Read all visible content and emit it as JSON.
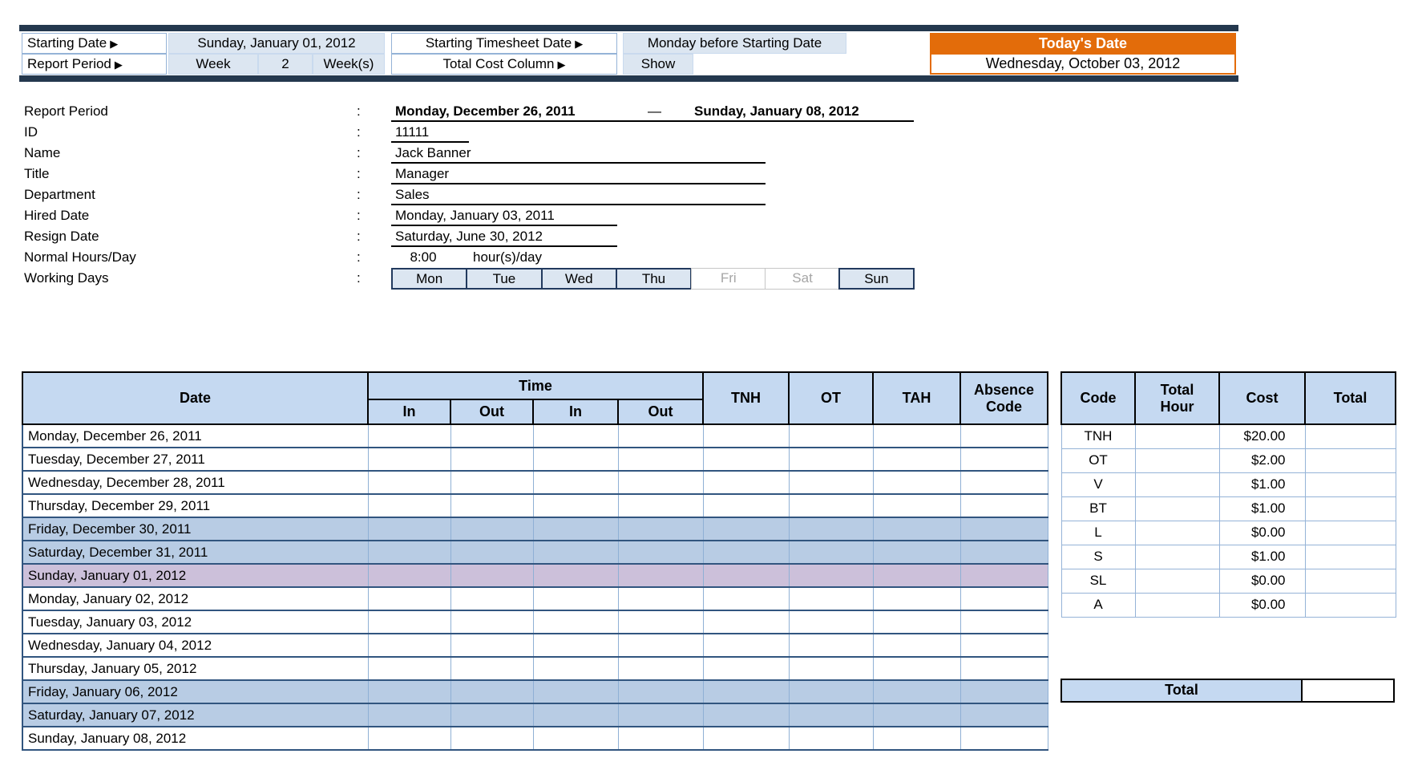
{
  "colors": {
    "accent_orange": "#e36c0a",
    "navy_bar": "#24384e",
    "table_header_fill": "#c5d9f1",
    "input_cell_fill": "#dce6f1",
    "weekend_row_fill": "#b8cce4",
    "start_date_row_fill": "#ccc0da"
  },
  "icons": {
    "triangle_right": "▶"
  },
  "topbar": {
    "starting_date": {
      "label": "Starting Date",
      "value": "Sunday, January 01, 2012"
    },
    "starting_timesheet_date": {
      "label": "Starting Timesheet Date",
      "value": "Monday before Starting Date"
    },
    "report_period": {
      "label": "Report Period",
      "unit": "Week",
      "count": "2",
      "unit_suffix": "Week(s)"
    },
    "total_cost_column": {
      "label": "Total Cost Column",
      "value": "Show"
    },
    "todays_date": {
      "label": "Today's Date",
      "value": "Wednesday, October 03, 2012"
    }
  },
  "info": {
    "colon": ":",
    "report_period": {
      "label": "Report Period",
      "start": "Monday, December 26, 2011",
      "dash": "—",
      "end": "Sunday, January 08, 2012"
    },
    "id": {
      "label": "ID",
      "value": "11111"
    },
    "name": {
      "label": "Name",
      "value": "Jack Banner"
    },
    "title": {
      "label": "Title",
      "value": "Manager"
    },
    "department": {
      "label": "Department",
      "value": "Sales"
    },
    "hired_date": {
      "label": "Hired Date",
      "value": "Monday, January 03, 2011"
    },
    "resign_date": {
      "label": "Resign Date",
      "value": "Saturday, June 30, 2012"
    },
    "normal_hours": {
      "label": "Normal Hours/Day",
      "value": "8:00",
      "unit": "hour(s)/day"
    },
    "working_days": {
      "label": "Working Days",
      "days": [
        {
          "label": "Mon",
          "active": true
        },
        {
          "label": "Tue",
          "active": true
        },
        {
          "label": "Wed",
          "active": true
        },
        {
          "label": "Thu",
          "active": true
        },
        {
          "label": "Fri",
          "active": false
        },
        {
          "label": "Sat",
          "active": false
        },
        {
          "label": "Sun",
          "active": true
        }
      ]
    }
  },
  "timesheet": {
    "headers": {
      "date": "Date",
      "time_group": "Time",
      "in1": "In",
      "out1": "Out",
      "in2": "In",
      "out2": "Out",
      "tnh": "TNH",
      "ot": "OT",
      "tah": "TAH",
      "absence_line1": "Absence",
      "absence_line2": "Code"
    },
    "rows": [
      {
        "date": "Monday, December 26, 2011",
        "type": "work"
      },
      {
        "date": "Tuesday, December 27, 2011",
        "type": "work"
      },
      {
        "date": "Wednesday, December 28, 2011",
        "type": "work"
      },
      {
        "date": "Thursday, December 29, 2011",
        "type": "work"
      },
      {
        "date": "Friday, December 30, 2011",
        "type": "off"
      },
      {
        "date": "Saturday, December 31, 2011",
        "type": "off"
      },
      {
        "date": "Sunday, January 01, 2012",
        "type": "start"
      },
      {
        "date": "Monday, January 02, 2012",
        "type": "work"
      },
      {
        "date": "Tuesday, January 03, 2012",
        "type": "work"
      },
      {
        "date": "Wednesday, January 04, 2012",
        "type": "work"
      },
      {
        "date": "Thursday, January 05, 2012",
        "type": "work"
      },
      {
        "date": "Friday, January 06, 2012",
        "type": "off"
      },
      {
        "date": "Saturday, January 07, 2012",
        "type": "off"
      },
      {
        "date": "Sunday, January 08, 2012",
        "type": "work"
      }
    ]
  },
  "cost_table": {
    "headers": {
      "code": "Code",
      "total_hour_line1": "Total",
      "total_hour_line2": "Hour",
      "cost": "Cost",
      "total": "Total"
    },
    "rows": [
      {
        "code": "TNH",
        "total_hour": "",
        "cost": "$20.00",
        "total": ""
      },
      {
        "code": "OT",
        "total_hour": "",
        "cost": "$2.00",
        "total": ""
      },
      {
        "code": "V",
        "total_hour": "",
        "cost": "$1.00",
        "total": ""
      },
      {
        "code": "BT",
        "total_hour": "",
        "cost": "$1.00",
        "total": ""
      },
      {
        "code": "L",
        "total_hour": "",
        "cost": "$0.00",
        "total": ""
      },
      {
        "code": "S",
        "total_hour": "",
        "cost": "$1.00",
        "total": ""
      },
      {
        "code": "SL",
        "total_hour": "",
        "cost": "$0.00",
        "total": ""
      },
      {
        "code": "A",
        "total_hour": "",
        "cost": "$0.00",
        "total": ""
      }
    ],
    "total_row": {
      "label": "Total",
      "value": ""
    }
  }
}
